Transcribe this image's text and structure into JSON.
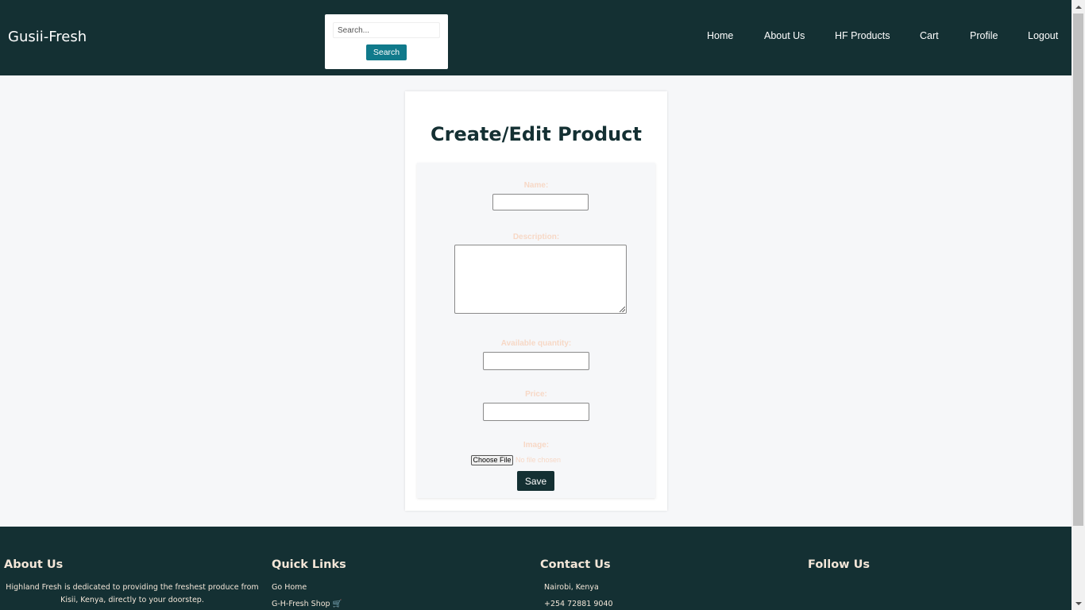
{
  "header": {
    "brand": "Gusii-Fresh",
    "search": {
      "placeholder": "Search...",
      "value": "",
      "button_label": "Search"
    },
    "nav": [
      "Home",
      "About Us",
      "HF Products",
      "Cart",
      "Profile",
      "Logout"
    ]
  },
  "form": {
    "title": "Create/Edit Product",
    "name_label": "Name:",
    "description_label": "Description:",
    "quantity_label": "Available quantity:",
    "price_label": "Price:",
    "image_label": "Image:",
    "choose_file_label": "Choose File",
    "file_status": "No file chosen",
    "save_label": "Save"
  },
  "footer": {
    "about": {
      "heading": "About Us",
      "text": "Highland Fresh is dedicated to providing the freshest produce from Kisii, Kenya, directly to your doorstep."
    },
    "quick_links": {
      "heading": "Quick Links",
      "links": [
        "Go Home",
        "G-H-Fresh Shop 🛒"
      ]
    },
    "contact": {
      "heading": "Contact Us",
      "lines": [
        "Nairobi, Kenya",
        "+254 72881 9040"
      ]
    },
    "follow": {
      "heading": "Follow Us"
    }
  },
  "colors": {
    "header_bg": "#143033",
    "accent_button": "#107a8b",
    "label_color": "#f7d8c6",
    "page_bg": "#f6f7f9"
  }
}
